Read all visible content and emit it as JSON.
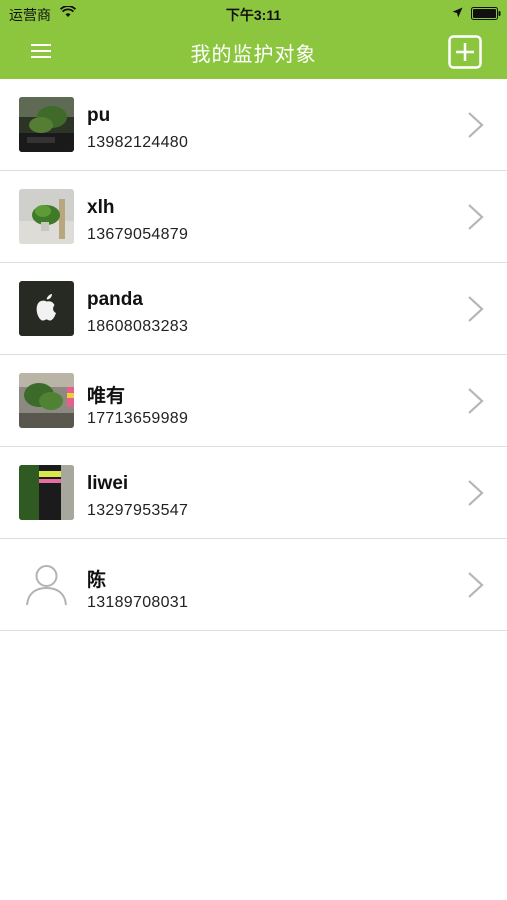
{
  "status_bar": {
    "carrier": "运营商",
    "time": "下午3:11"
  },
  "nav": {
    "title": "我的监护对象",
    "menu_icon": "menu-icon",
    "add_icon": "add-icon"
  },
  "contacts": [
    {
      "name": "pu",
      "phone": "13982124480",
      "avatar": "plant-photo"
    },
    {
      "name": "xlh",
      "phone": "13679054879",
      "avatar": "plant-photo"
    },
    {
      "name": "panda",
      "phone": "18608083283",
      "avatar": "apple-logo"
    },
    {
      "name": "唯有",
      "phone": "17713659989",
      "avatar": "plant-photo"
    },
    {
      "name": "liwei",
      "phone": "13297953547",
      "avatar": "bottle-photo"
    },
    {
      "name": "陈",
      "phone": "13189708031",
      "avatar": "default-user-icon"
    }
  ],
  "colors": {
    "header": "#8cc63f",
    "divider": "#dcdcdc",
    "chevron": "#b5b5b5"
  }
}
